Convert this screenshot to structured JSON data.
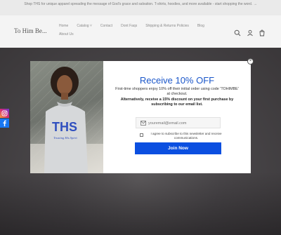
{
  "announcement": {
    "text": "Shop THS for unique apparel spreading the message of God's grace and salvation. T-shirts, hoodies, and more available - start shopping the word.",
    "arrow": "→"
  },
  "header": {
    "logo": "To Him Be...",
    "nav": [
      "Home",
      "Catalog",
      "Contact",
      "Dont Faqs",
      "Shipping & Returns Policies",
      "Blog",
      "About Us"
    ]
  },
  "popup": {
    "title": "Receive 10% OFF",
    "body1": "First-time shoppers enjoy 10% off their initial order using code 'TOHIMBE' at checkout.",
    "body2": "Alternatively, receive a 15% discount on your first purchase by subscribing to our email list.",
    "email_placeholder": "youremail@email.com",
    "consent": "I agree to subscribe to this newsletter and receive communications.",
    "cta": "Join Now",
    "close": "×",
    "shirt_text": "THS",
    "shirt_script": "Trusting His Spirit"
  },
  "social": [
    "instagram-icon",
    "facebook-icon"
  ],
  "colors": {
    "accent": "#1a56c9",
    "button": "#0b4fe0"
  }
}
